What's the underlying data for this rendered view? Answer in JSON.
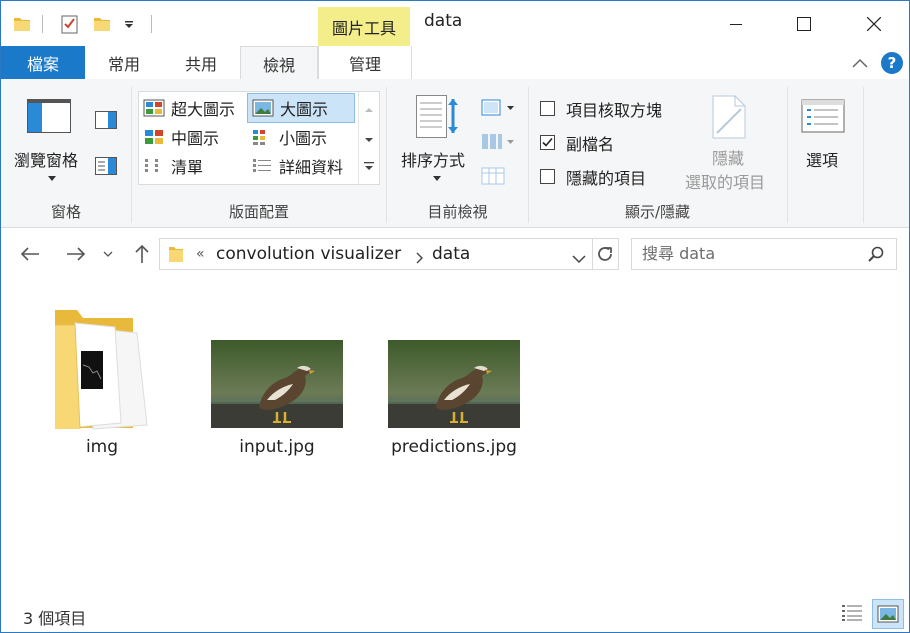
{
  "window": {
    "title": "data",
    "contextual_tab": "圖片工具"
  },
  "tabs": [
    {
      "label": "檔案"
    },
    {
      "label": "常用"
    },
    {
      "label": "共用"
    },
    {
      "label": "檢視"
    },
    {
      "label": "管理"
    }
  ],
  "ribbon": {
    "pane_group": {
      "label": "窗格",
      "nav_pane": "瀏覽窗格"
    },
    "layout_group": {
      "label": "版面配置",
      "items": [
        {
          "label": "超大圖示"
        },
        {
          "label": "大圖示"
        },
        {
          "label": "中圖示"
        },
        {
          "label": "小圖示"
        },
        {
          "label": "清單"
        },
        {
          "label": "詳細資料"
        }
      ],
      "selected": "大圖示"
    },
    "current_view_group": {
      "label": "目前檢視",
      "sort": "排序方式"
    },
    "show_hide_group": {
      "label": "顯示/隱藏",
      "checkboxes": [
        {
          "label": "項目核取方塊",
          "checked": false
        },
        {
          "label": "副檔名",
          "checked": true
        },
        {
          "label": "隱藏的項目",
          "checked": false
        }
      ],
      "hide_selected_line1": "隱藏",
      "hide_selected_line2": "選取的項目"
    },
    "options": "選項"
  },
  "address": {
    "overflow": "«",
    "crumbs": [
      "convolution visualizer",
      "data"
    ]
  },
  "search": {
    "placeholder": "搜尋 data"
  },
  "files": [
    {
      "name": "img",
      "kind": "folder"
    },
    {
      "name": "input.jpg",
      "kind": "image"
    },
    {
      "name": "predictions.jpg",
      "kind": "image"
    }
  ],
  "status": {
    "count_text": "3 個項目"
  },
  "colors": {
    "accent": "#1a79c9",
    "tool_tab": "#f3ee8a",
    "selected": "#cce4f7"
  }
}
